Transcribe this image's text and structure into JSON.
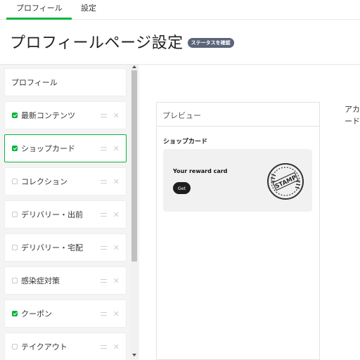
{
  "tabs": [
    {
      "label": "プロフィール",
      "active": true
    },
    {
      "label": "設定",
      "active": false
    }
  ],
  "header": {
    "title": "プロフィールページ設定",
    "status_badge": "ステータスを確認"
  },
  "sidebar": {
    "header_item": "プロフィール",
    "items": [
      {
        "label": "最新コンテンツ",
        "checked": true
      },
      {
        "label": "ショップカード",
        "checked": true,
        "selected": true
      },
      {
        "label": "コレクション",
        "checked": false
      },
      {
        "label": "デリバリー・出前",
        "checked": false
      },
      {
        "label": "デリバリー・宅配",
        "checked": false
      },
      {
        "label": "感染症対策",
        "checked": false
      },
      {
        "label": "クーポン",
        "checked": true
      },
      {
        "label": "テイクアウト",
        "checked": false
      }
    ]
  },
  "preview": {
    "title": "プレビュー",
    "section_title": "ショップカード",
    "card_title": "Your reward card",
    "card_button": "Get",
    "stamp_text": "STAMP"
  },
  "right_panel": {
    "line1": "アカ",
    "line2": "ード"
  },
  "colors": {
    "accent": "#07b53b",
    "badge": "#5b6478"
  },
  "icons": {
    "drag": "drag-handle-icon",
    "delete": "close-icon"
  }
}
